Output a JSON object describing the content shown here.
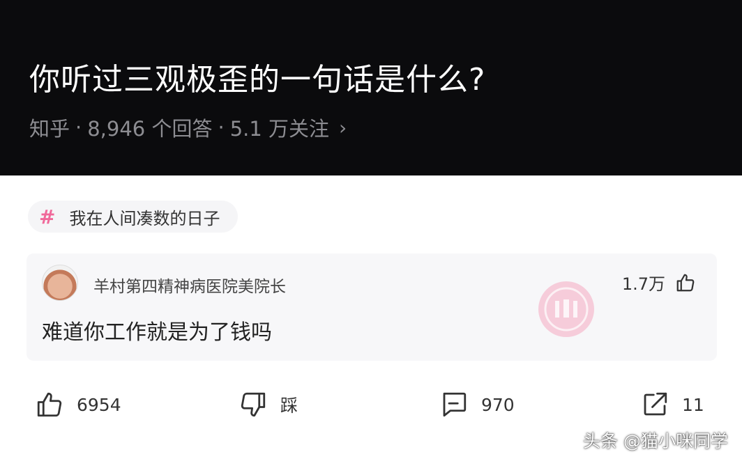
{
  "header": {
    "title": "你听过三观极歪的一句话是什么?",
    "source": "知乎",
    "answers": "8,946 个回答",
    "follows": "5.1 万关注",
    "sep": "·",
    "chevron": "›"
  },
  "topic": {
    "hash": "#",
    "label": "我在人间凑数的日子"
  },
  "comment_card": {
    "author": "羊村第四精神病医院美院长",
    "likes": "1.7万",
    "text": "难道你工作就是为了钱吗"
  },
  "actions": {
    "like_count": "6954",
    "dislike_label": "踩",
    "comment_count": "970",
    "share_count": "11"
  },
  "watermark": "头条 @猫小咪同学",
  "colors": {
    "header_bg": "#0b0b0d",
    "topic_hash": "#f0699a",
    "stamp": "#f6a9c1"
  }
}
